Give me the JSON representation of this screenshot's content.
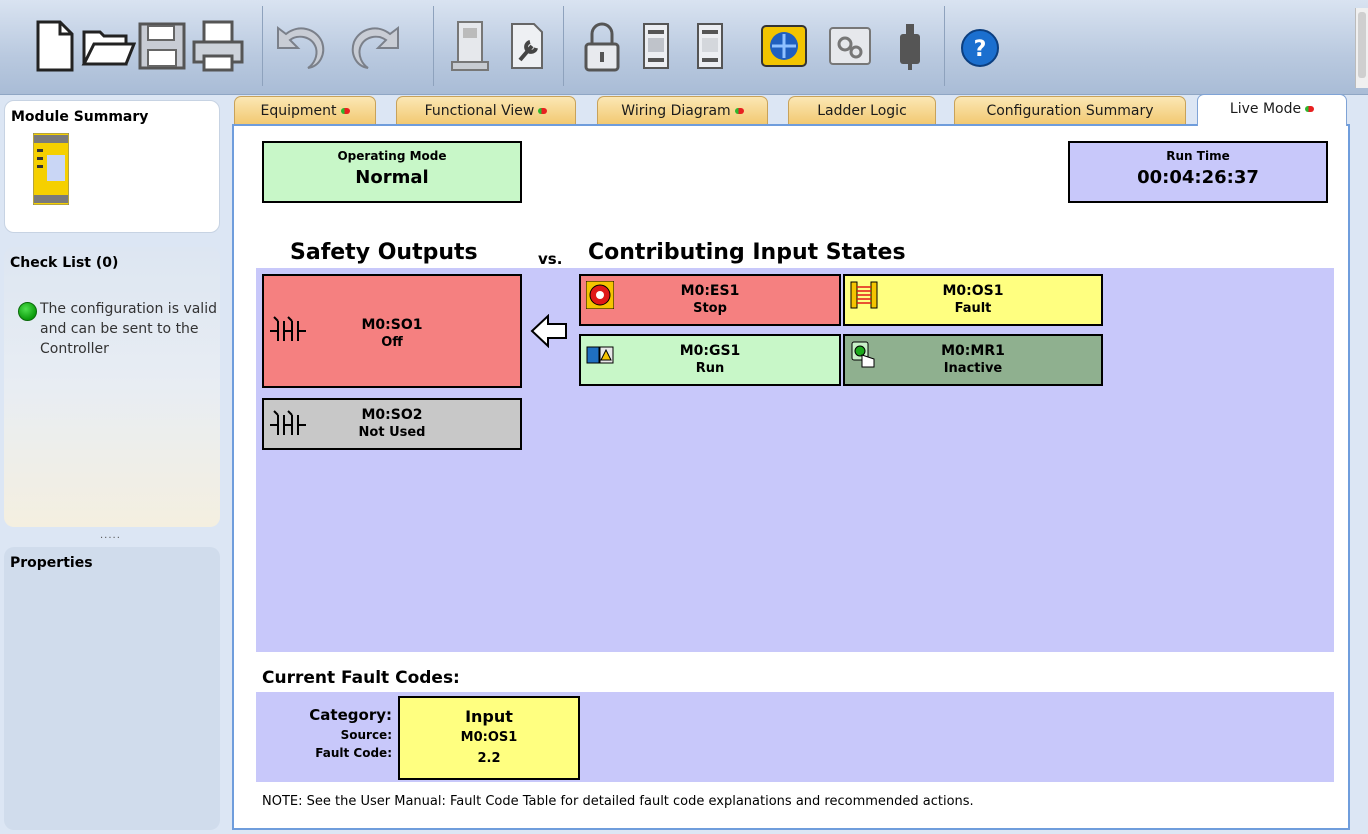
{
  "toolbar": {
    "buttons": [
      {
        "icon": "new-file-icon"
      },
      {
        "icon": "open-folder-icon"
      },
      {
        "icon": "save-icon"
      },
      {
        "icon": "print-icon"
      },
      {
        "icon": "undo-icon"
      },
      {
        "icon": "redo-icon"
      },
      {
        "icon": "controller-icon"
      },
      {
        "icon": "settings-wrench-icon"
      },
      {
        "icon": "lock-icon"
      },
      {
        "icon": "module-icon"
      },
      {
        "icon": "module-alt-icon"
      },
      {
        "icon": "connect-network-icon"
      },
      {
        "icon": "gears-icon"
      },
      {
        "icon": "usb-plug-icon"
      },
      {
        "icon": "help-icon"
      }
    ]
  },
  "sidebar": {
    "module_summary_title": "Module Summary",
    "checklist_title": "Check List (0)",
    "checklist_message": "The configuration is valid and can be sent to the Controller",
    "properties_title": "Properties",
    "splitter": "....."
  },
  "tabs": [
    {
      "label": "Equipment",
      "has_status_dot": true
    },
    {
      "label": "Functional View",
      "has_status_dot": true
    },
    {
      "label": "Wiring Diagram",
      "has_status_dot": true
    },
    {
      "label": "Ladder Logic",
      "has_status_dot": false
    },
    {
      "label": "Configuration Summary",
      "has_status_dot": false
    },
    {
      "label": "Live Mode",
      "has_status_dot": true,
      "active": true
    }
  ],
  "live": {
    "operating_mode_label": "Operating Mode",
    "operating_mode_value": "Normal",
    "run_time_label": "Run Time",
    "run_time_value": "00:04:26:37",
    "safety_outputs_title": "Safety Outputs",
    "vs_label": "vs.",
    "inputs_title": "Contributing Input States",
    "outputs": [
      {
        "id": "M0:SO1",
        "state": "Off",
        "color": "#f58080"
      },
      {
        "id": "M0:SO2",
        "state": "Not Used",
        "color": "#c8c8c8"
      }
    ],
    "inputs": [
      {
        "id": "M0:ES1",
        "state": "Stop",
        "color": "#f58080",
        "icon": "emergency-stop-icon"
      },
      {
        "id": "M0:OS1",
        "state": "Fault",
        "color": "#ffff80",
        "icon": "light-curtain-icon"
      },
      {
        "id": "M0:GS1",
        "state": "Run",
        "color": "#c8f7c8",
        "icon": "gate-switch-icon"
      },
      {
        "id": "M0:MR1",
        "state": "Inactive",
        "color": "#8fb08f",
        "icon": "manual-reset-icon"
      }
    ],
    "fault_title": "Current Fault Codes:",
    "fault_category_label": "Category:",
    "fault_source_label": "Source:",
    "fault_code_label": "Fault Code:",
    "fault_category": "Input",
    "fault_source": "M0:OS1",
    "fault_code": "2.2",
    "note": "NOTE: See the User Manual: Fault Code Table for detailed fault code explanations and recommended actions."
  },
  "colors": {
    "accent_blue": "#6f9ddc",
    "band": "#c8c8fa",
    "mode_green": "#c8f7c8",
    "runtime_lavender": "#c8c8fa",
    "fault_yellow": "#ffff80"
  }
}
